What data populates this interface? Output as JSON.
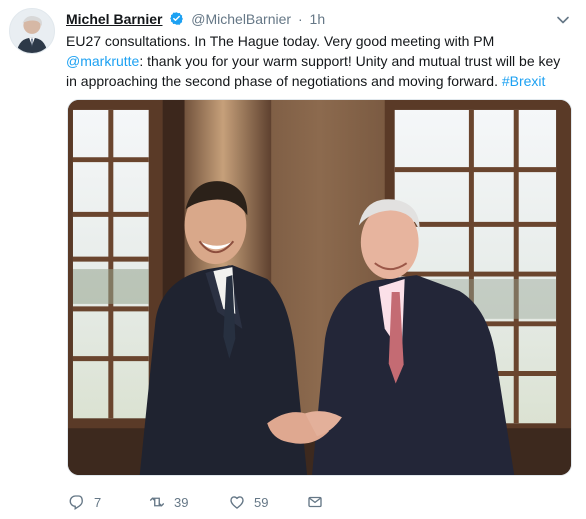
{
  "tweet": {
    "author": {
      "name": "Michel Barnier",
      "handle": "@MichelBarnier",
      "separator": "·",
      "time": "1h"
    },
    "text_lines": {
      "line1": "EU27 consultations. In The Hague today. Very good meeting with PM",
      "line2_mention": "@markrutte",
      "line2_rest": ": thank you for your warm support! Unity and mutual trust will be key",
      "line3_rest": "in approaching the second phase of negotiations and moving forward. ",
      "line3_hashtag": "#Brexit"
    },
    "media": {
      "description_icon": "photo-two-men-handshake"
    },
    "actions": {
      "replies": "7",
      "retweets": "39",
      "likes": "59"
    },
    "colors": {
      "link": "#1da1f2",
      "secondary": "#657786",
      "verified": "#1da1f2"
    },
    "icons": [
      "reply-icon",
      "retweet-icon",
      "like-icon",
      "direct-message-icon",
      "verified-icon",
      "caret-down-icon"
    ]
  }
}
